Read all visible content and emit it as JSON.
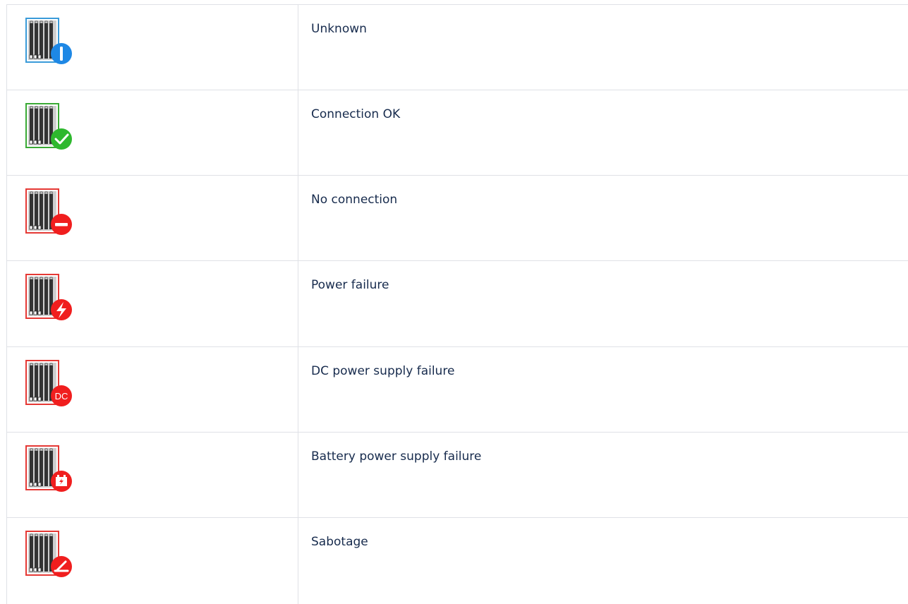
{
  "rows": [
    {
      "label": "Unknown",
      "state": "unknown",
      "frame_color": "#3a9bd9",
      "badge_color": "#1e88e5",
      "badge_icon": "info-icon"
    },
    {
      "label": "Connection OK",
      "state": "ok",
      "frame_color": "#3aaa35",
      "badge_color": "#2eb82e",
      "badge_icon": "check-icon"
    },
    {
      "label": "No connection",
      "state": "no-connection",
      "frame_color": "#e53935",
      "badge_color": "#f01e1e",
      "badge_icon": "minus-icon"
    },
    {
      "label": "Power failure",
      "state": "power-failure",
      "frame_color": "#e53935",
      "badge_color": "#f01e1e",
      "badge_icon": "lightning-icon"
    },
    {
      "label": "DC power supply failure",
      "state": "dc-failure",
      "frame_color": "#e53935",
      "badge_color": "#f01e1e",
      "badge_icon": "dc-icon",
      "badge_text": "DC"
    },
    {
      "label": "Battery power supply failure",
      "state": "battery-failure",
      "frame_color": "#e53935",
      "badge_color": "#f01e1e",
      "badge_icon": "battery-icon"
    },
    {
      "label": "Sabotage",
      "state": "sabotage",
      "frame_color": "#e53935",
      "badge_color": "#f01e1e",
      "badge_icon": "tamper-icon"
    }
  ]
}
